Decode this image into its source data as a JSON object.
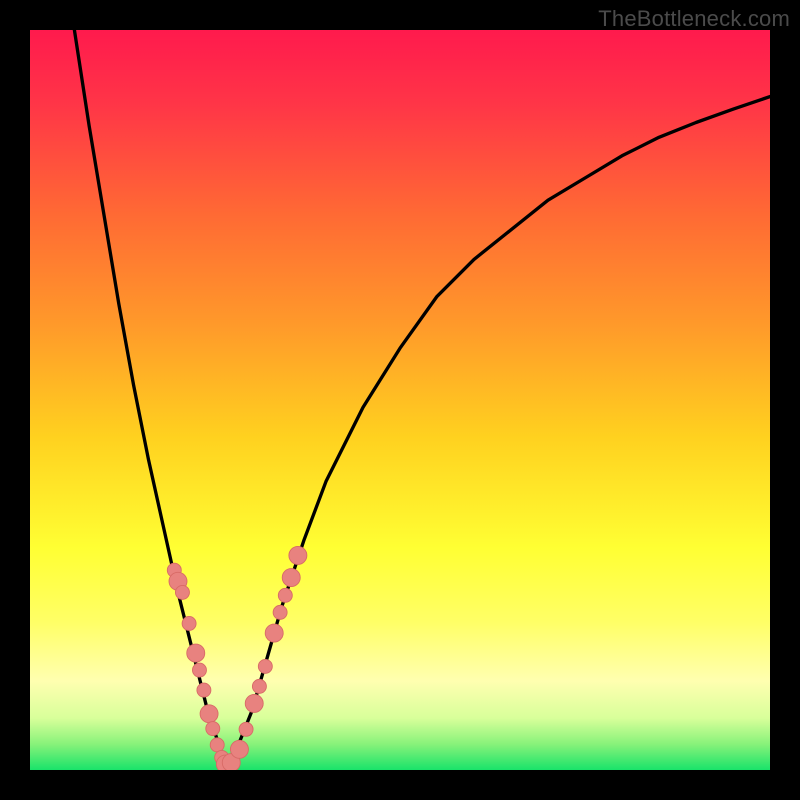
{
  "watermark": "TheBottleneck.com",
  "colors": {
    "frame": "#000000",
    "curve": "#000000",
    "dot_fill": "#e8827f",
    "dot_stroke": "#d86a66",
    "gradient_stops": [
      {
        "offset": 0.0,
        "color": "#ff1a4d"
      },
      {
        "offset": 0.1,
        "color": "#ff3547"
      },
      {
        "offset": 0.25,
        "color": "#ff6a34"
      },
      {
        "offset": 0.4,
        "color": "#ff9a2a"
      },
      {
        "offset": 0.55,
        "color": "#ffd11f"
      },
      {
        "offset": 0.7,
        "color": "#ffff33"
      },
      {
        "offset": 0.8,
        "color": "#ffff66"
      },
      {
        "offset": 0.88,
        "color": "#ffffb0"
      },
      {
        "offset": 0.93,
        "color": "#d8ff9a"
      },
      {
        "offset": 0.965,
        "color": "#88f27a"
      },
      {
        "offset": 1.0,
        "color": "#19e36a"
      }
    ]
  },
  "chart_data": {
    "type": "line",
    "title": "",
    "xlabel": "",
    "ylabel": "",
    "xlim": [
      0,
      100
    ],
    "ylim": [
      0,
      100
    ],
    "series": [
      {
        "name": "left-branch",
        "x": [
          6,
          8,
          10,
          12,
          14,
          16,
          18,
          20,
          21,
          22,
          23,
          24,
          25,
          26,
          26.7
        ],
        "y": [
          100,
          87,
          75,
          63,
          52,
          42,
          33,
          24,
          20,
          16,
          12,
          8,
          5,
          2,
          0.5
        ]
      },
      {
        "name": "right-branch",
        "x": [
          26.7,
          28,
          30,
          32,
          34,
          37,
          40,
          45,
          50,
          55,
          60,
          65,
          70,
          75,
          80,
          85,
          90,
          95,
          100
        ],
        "y": [
          0.5,
          3,
          8,
          15,
          22,
          31,
          39,
          49,
          57,
          64,
          69,
          73,
          77,
          80,
          83,
          85.5,
          87.5,
          89.3,
          91
        ]
      }
    ],
    "scatter": [
      {
        "name": "left-dots",
        "x": [
          19.5,
          20.0,
          20.6,
          21.5,
          22.4,
          22.9,
          23.5,
          24.2,
          24.7,
          25.3,
          25.9,
          26.4
        ],
        "y": [
          27.0,
          25.5,
          24.0,
          19.8,
          15.8,
          13.5,
          10.8,
          7.6,
          5.6,
          3.4,
          1.7,
          0.8
        ],
        "r": [
          7,
          9,
          7,
          7,
          9,
          7,
          7,
          9,
          7,
          7,
          7,
          9
        ]
      },
      {
        "name": "valley-dots",
        "x": [
          27.2,
          28.3,
          29.2
        ],
        "y": [
          1.0,
          2.8,
          5.5
        ],
        "r": [
          9,
          9,
          7
        ]
      },
      {
        "name": "right-dots",
        "x": [
          30.3,
          31.0,
          31.8,
          33.0,
          33.8,
          34.5,
          35.3,
          36.2
        ],
        "y": [
          9.0,
          11.3,
          14.0,
          18.5,
          21.3,
          23.6,
          26.0,
          29.0
        ],
        "r": [
          9,
          7,
          7,
          9,
          7,
          7,
          9,
          9
        ]
      }
    ]
  }
}
